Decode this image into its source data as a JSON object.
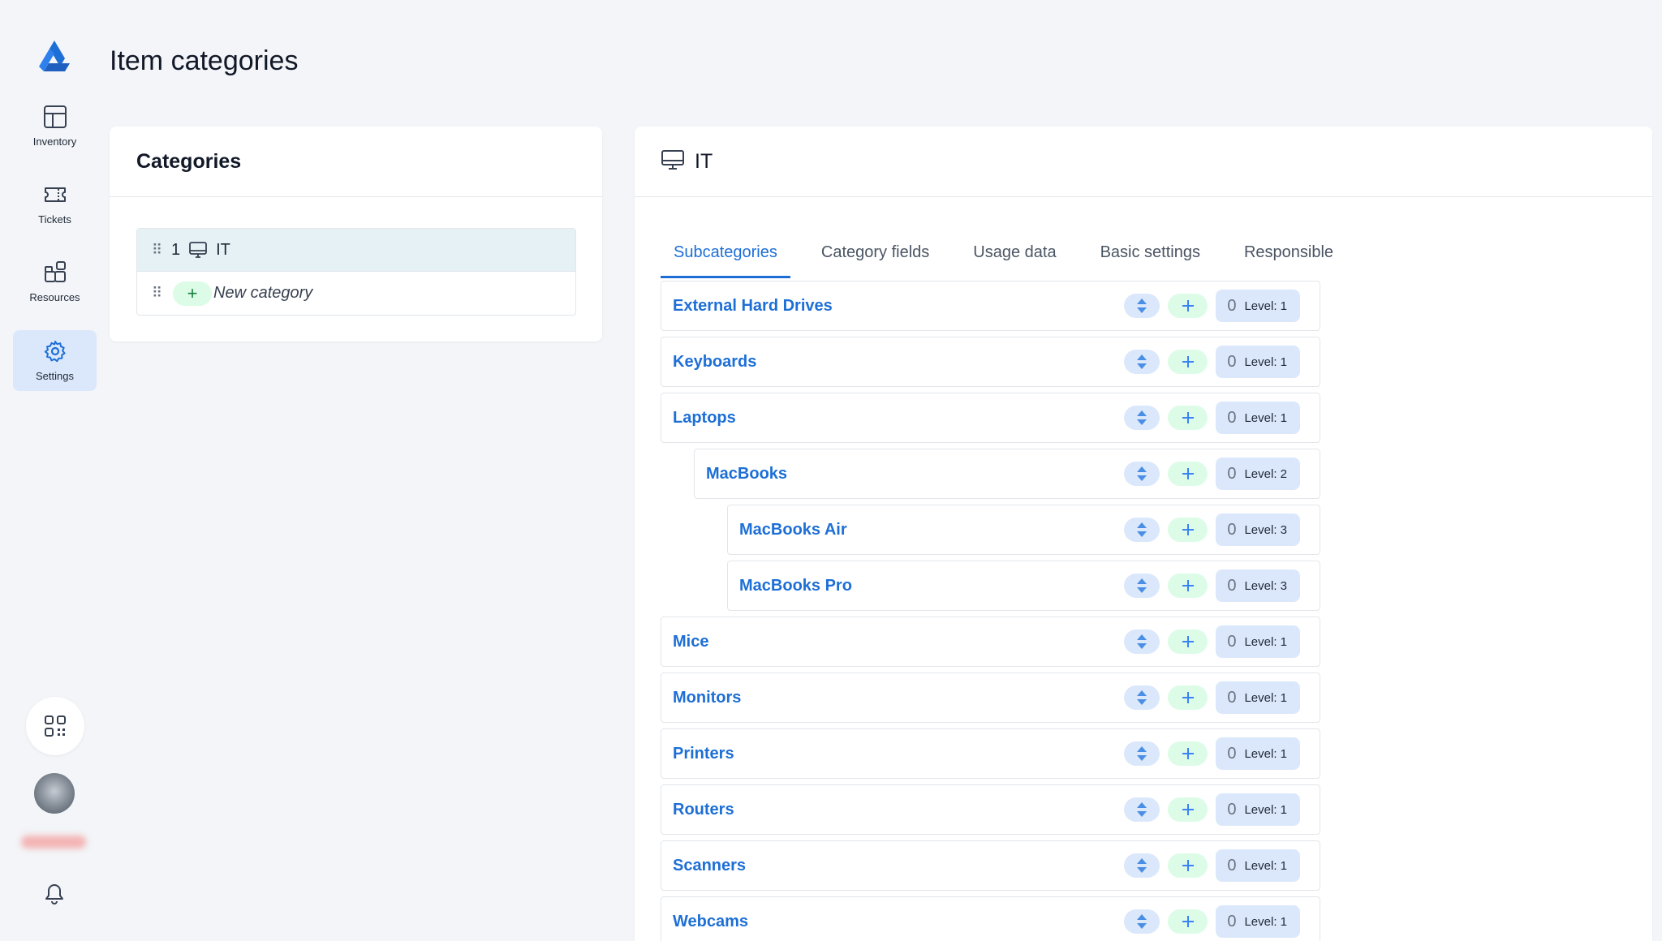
{
  "app": {
    "page_title": "Item categories"
  },
  "sidebar": {
    "items": [
      {
        "label": "Inventory",
        "icon": "table-icon"
      },
      {
        "label": "Tickets",
        "icon": "ticket-icon"
      },
      {
        "label": "Resources",
        "icon": "resources-icon"
      },
      {
        "label": "Settings",
        "icon": "gear-icon",
        "active": true
      }
    ]
  },
  "categories": {
    "title": "Categories",
    "items": [
      {
        "num": "1",
        "label": "IT"
      }
    ],
    "new_label": "New category"
  },
  "detail": {
    "title": "IT",
    "tabs": [
      "Subcategories",
      "Category fields",
      "Usage data",
      "Basic settings",
      "Responsible"
    ],
    "active_tab": "Subcategories",
    "subcategories": [
      {
        "name": "External Hard Drives",
        "count": "0",
        "level": "Level: 1"
      },
      {
        "name": "Keyboards",
        "count": "0",
        "level": "Level: 1"
      },
      {
        "name": "Laptops",
        "count": "0",
        "level": "Level: 1"
      },
      {
        "name": "MacBooks",
        "count": "0",
        "level": "Level: 2"
      },
      {
        "name": "MacBooks Air",
        "count": "0",
        "level": "Level: 3"
      },
      {
        "name": "MacBooks Pro",
        "count": "0",
        "level": "Level: 3"
      },
      {
        "name": "Mice",
        "count": "0",
        "level": "Level: 1"
      },
      {
        "name": "Monitors",
        "count": "0",
        "level": "Level: 1"
      },
      {
        "name": "Printers",
        "count": "0",
        "level": "Level: 1"
      },
      {
        "name": "Routers",
        "count": "0",
        "level": "Level: 1"
      },
      {
        "name": "Scanners",
        "count": "0",
        "level": "Level: 1"
      },
      {
        "name": "Webcams",
        "count": "0",
        "level": "Level: 1"
      }
    ]
  },
  "colors": {
    "accent": "#1d6fd6",
    "active_bg": "#dbe8fb",
    "green_bg": "#dcfce7"
  }
}
